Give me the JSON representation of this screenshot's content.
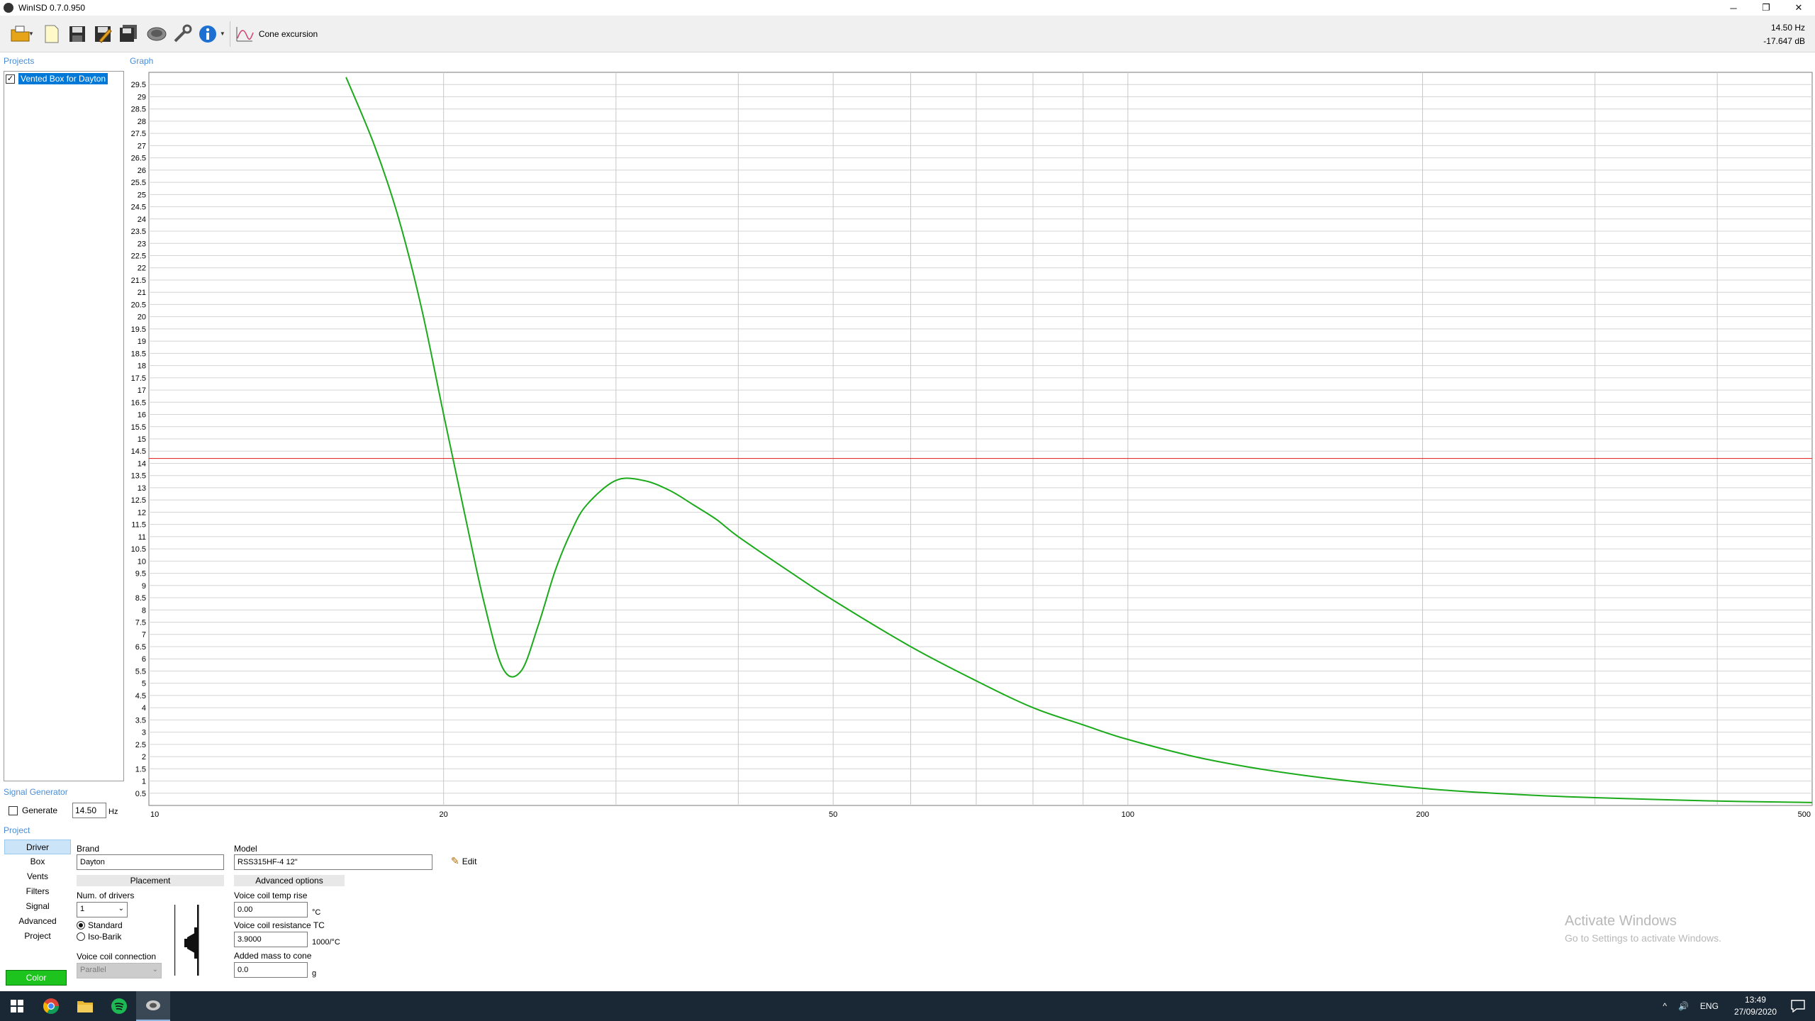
{
  "window": {
    "title": "WinISD 0.7.0.950",
    "controls": [
      "─",
      "❐",
      "✕"
    ]
  },
  "toolbar": {
    "buttons": [
      "open-project-icon",
      "new-file-icon",
      "save-icon",
      "save-as-icon",
      "save-all-icon",
      "driver-icon",
      "tools-icon",
      "info-icon"
    ],
    "mode_label": "Cone excursion"
  },
  "readout": {
    "frequency": "14.50 Hz",
    "value": "-17.647 dB"
  },
  "sidebar": {
    "projects_label": "Projects",
    "graph_label": "Graph",
    "project_items": [
      {
        "name": "Vented Box for Dayton",
        "checked": true
      }
    ],
    "signal_generator_label": "Signal Generator",
    "generate_label": "Generate",
    "generate_checked": false,
    "frequency_value": "14.50",
    "frequency_unit": "Hz"
  },
  "project_nav": {
    "label": "Project",
    "items": [
      "Driver",
      "Box",
      "Vents",
      "Filters",
      "Signal",
      "Advanced",
      "Project"
    ],
    "active": "Driver",
    "color_button": "Color",
    "color_hex": "#1ec41e"
  },
  "driver": {
    "brand_label": "Brand",
    "brand_value": "Dayton",
    "model_label": "Model",
    "model_value": "RSS315HF-4 12\"",
    "edit_label": "Edit",
    "placement_header": "Placement",
    "num_drivers_label": "Num. of drivers",
    "num_drivers_value": "1",
    "radio_standard": "Standard",
    "radio_isobarik": "Iso-Barik",
    "standard_selected": true,
    "vc_connection_label": "Voice coil connection",
    "vc_connection_value": "Parallel",
    "advanced_header": "Advanced options",
    "vc_temp_label": "Voice coil temp rise",
    "vc_temp_value": "0.00",
    "vc_temp_unit": "°C",
    "vc_res_label": "Voice coil resistance TC",
    "vc_res_value": "3.9000",
    "vc_res_unit": "1000/°C",
    "added_mass_label": "Added mass to cone",
    "added_mass_value": "0.0",
    "added_mass_unit": "g"
  },
  "watermark": {
    "title": "Activate Windows",
    "subtitle": "Go to Settings to activate Windows."
  },
  "taskbar": {
    "apps": [
      "windows-start-icon",
      "chrome-icon",
      "file-explorer-icon",
      "spotify-icon",
      "winisd-icon"
    ],
    "tray": {
      "chevron": "^",
      "speaker": "🔊",
      "language": "ENG",
      "time": "13:49",
      "date": "27/09/2020"
    }
  },
  "chart_data": {
    "type": "line",
    "title": "",
    "xlabel": "",
    "ylabel": "",
    "xscale": "log",
    "xlim": [
      10,
      500
    ],
    "ylim": [
      0,
      30
    ],
    "x_tick_labels": [
      "10",
      "20",
      "50",
      "100",
      "200",
      "500"
    ],
    "y_tick_labels": [
      "0.5",
      "1",
      "1.5",
      "2",
      "2.5",
      "3",
      "3.5",
      "4",
      "4.5",
      "5",
      "5.5",
      "6",
      "6.5",
      "7",
      "7.5",
      "8",
      "8.5",
      "9",
      "9.5",
      "10",
      "10.5",
      "11",
      "11.5",
      "12",
      "12.5",
      "13",
      "13.5",
      "14",
      "14.5",
      "15",
      "15.5",
      "16",
      "16.5",
      "17",
      "17.5",
      "18",
      "18.5",
      "19",
      "19.5",
      "20",
      "20.5",
      "21",
      "21.5",
      "22",
      "22.5",
      "23",
      "23.5",
      "24",
      "24.5",
      "25",
      "25.5",
      "26",
      "26.5",
      "27",
      "27.5",
      "28",
      "28.5",
      "29",
      "29.5"
    ],
    "grid": true,
    "series": [
      {
        "color": "#1aaa1a",
        "x": [
          15.9,
          17,
          18,
          19,
          20,
          21,
          22,
          23,
          24,
          25,
          26,
          27,
          28,
          30,
          32,
          34,
          36,
          38,
          40,
          45,
          50,
          60,
          70,
          80,
          90,
          100,
          120,
          150,
          200,
          250,
          300,
          400,
          500
        ],
        "y": [
          29.8,
          27.0,
          24.0,
          20.3,
          16.0,
          12.0,
          8.3,
          5.6,
          5.5,
          7.4,
          9.6,
          11.2,
          12.3,
          13.3,
          13.3,
          12.9,
          12.3,
          11.7,
          11.0,
          9.6,
          8.4,
          6.5,
          5.1,
          4.0,
          3.3,
          2.7,
          1.9,
          1.25,
          0.7,
          0.45,
          0.32,
          0.18,
          0.12
        ]
      }
    ],
    "reference_line": {
      "y": 14.2,
      "color": "#e03030"
    }
  }
}
